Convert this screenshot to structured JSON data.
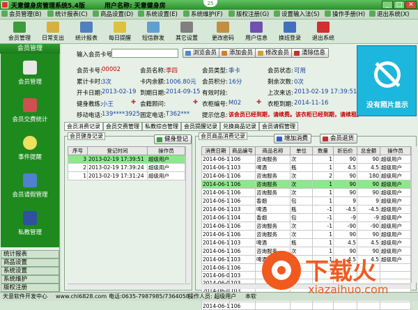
{
  "title": "天意健身房管理系统5.4版",
  "username_label": "用户名称: 天意健身房",
  "badge": "25",
  "menu": [
    "会员管理(B)",
    "统计报表(C)",
    "商品设置(D)",
    "系统设置(E)",
    "系统维护(F)",
    "版权注册(G)",
    "设置输入法(S)",
    "操作手册(H)",
    "退出系统(X)"
  ],
  "toolbar": [
    "会员管理",
    "日常支出",
    "统计报表",
    "每日提醒",
    "短信群发",
    "其它设置",
    "更改密码",
    "用户信息",
    "换班登录",
    "退出系统"
  ],
  "left": {
    "header": "会员管理",
    "nav": [
      "会员管理",
      "会员交费统计",
      "事件提醒",
      "会员请假管理",
      "私教管理"
    ],
    "bottom": [
      "统计报表",
      "商品设置",
      "系统设置",
      "系统维护",
      "版权注册"
    ]
  },
  "form": {
    "card_input_label": "输入会员卡号:",
    "card_value": "",
    "btn_browse": "浏览会员",
    "btn_add": "添加会员",
    "btn_edit": "修改会员",
    "btn_clear": "清除信息",
    "fields": {
      "card_no_label": "会员卡号:",
      "card_no": "00002",
      "name_label": "会员名称:",
      "name": "李四",
      "type_label": "会员类型:",
      "type": "季卡",
      "status_label": "会员状态:",
      "status": "可用",
      "times_label": "累计卡时:",
      "times": "3次",
      "balance_label": "卡内余额:",
      "balance": "1006.80元",
      "points_label": "会员积分:",
      "points": "16分",
      "remain_label": "剩余次数:",
      "remain": "0次",
      "open_label": "开卡日期:",
      "open": "2013-02-19",
      "expire_label": "到期日期:",
      "expire": "2014-09-15",
      "valid_label": "有效时段:",
      "valid": "",
      "last_label": "上次来访:",
      "last": "2013-02-19 17:39:51",
      "coach_label": "健身教练:",
      "coach": "小王",
      "consultant_label": "会籍顾问:",
      "consultant": "",
      "locker_label": "衣柜编号:",
      "locker": "M02",
      "locker_exp_label": "衣柜到期:",
      "locker_exp": "2014-11-16",
      "mobile_label": "移动电话:",
      "mobile": "139****3925",
      "phone_label": "固定电话:",
      "phone": "T362***",
      "notice_label": "提示信息:",
      "notice": "该会员已经到期，请续费。该衣柜已经到期，请续租。"
    },
    "no_image": "没有照片显示"
  },
  "tabs": [
    "会员消费记录",
    "会员交费管理",
    "私教综合管理",
    "会员提醒记录",
    "兑换商品记录",
    "会员请假管理"
  ],
  "fitness": {
    "group_title": "会员健身记录",
    "btn": "健身登记",
    "headers": [
      "序号",
      "登记时间",
      "操作员"
    ],
    "rows": [
      [
        "3",
        "2013-02-19 17:39:51",
        "超级用户"
      ],
      [
        "2",
        "2013-02-19 17:39:24",
        "超级用户"
      ],
      [
        "1",
        "2013-02-19 17:31:24",
        "超级用户"
      ]
    ]
  },
  "goods": {
    "group_title": "会员商品消费记录",
    "btn_add": "增加消费",
    "btn_return": "会员退货",
    "headers": [
      "消费日期",
      "商品编号",
      "商品名称",
      "单位",
      "数量",
      "折后价",
      "总金额",
      "操作员"
    ],
    "rows": [
      [
        "2014-06-12",
        "106",
        "咨询服务",
        "次",
        "1",
        "90",
        "90",
        "超级用户"
      ],
      [
        "2014-06-12",
        "103",
        "啤酒",
        "瓶",
        "1",
        "4.5",
        "4.5",
        "超级用户"
      ],
      [
        "2014-06-12",
        "106",
        "咨询服务",
        "次",
        "2",
        "90",
        "180",
        "超级用户"
      ],
      [
        "2014-06-12",
        "106",
        "咨询服务",
        "次",
        "1",
        "90",
        "90",
        "超级用户"
      ],
      [
        "2014-06-12",
        "106",
        "咨询服务",
        "次",
        "1",
        "90",
        "90",
        "超级用户"
      ],
      [
        "2014-06-12",
        "106",
        "香烟",
        "包",
        "1",
        "9",
        "9",
        "超级用户"
      ],
      [
        "2014-06-11",
        "103",
        "啤酒",
        "瓶",
        "-1",
        "-4.5",
        "-4.5",
        "超级用户"
      ],
      [
        "2014-06-11",
        "104",
        "香烟",
        "包",
        "-1",
        "-9",
        "-9",
        "超级用户"
      ],
      [
        "2014-06-11",
        "106",
        "咨询服务",
        "次",
        "-1",
        "-90",
        "-90",
        "超级用户"
      ],
      [
        "2014-06-11",
        "106",
        "咨询服务",
        "次",
        "1",
        "90",
        "90",
        "超级用户"
      ],
      [
        "2014-06-11",
        "103",
        "啤酒",
        "瓶",
        "1",
        "4.5",
        "4.5",
        "超级用户"
      ],
      [
        "2014-06-11",
        "106",
        "咨询服务",
        "次",
        "1",
        "90",
        "90",
        "超级用户"
      ],
      [
        "2014-06-11",
        "103",
        "啤酒",
        "瓶",
        "1",
        "4.5",
        "4.5",
        "超级用户"
      ],
      [
        "2014-06-11",
        "106",
        "",
        "",
        "",
        "",
        "",
        ""
      ],
      [
        "2014-06-08",
        "103",
        "",
        "",
        "",
        "",
        "",
        ""
      ],
      [
        "2014-06-08",
        "103",
        "",
        "",
        "",
        "",
        "",
        ""
      ],
      [
        "2014-06-08",
        "103",
        "",
        "",
        "",
        "",
        "",
        ""
      ],
      [
        "2014-06-11",
        "106",
        "",
        "",
        "",
        "",
        "",
        ""
      ],
      [
        "2014-06-11",
        "106",
        "",
        "",
        "",
        "",
        "",
        ""
      ]
    ]
  },
  "status": {
    "company": "天意软件开发中心",
    "site": "www.chl6828.com",
    "tel": "电话:0635-7987985/7364058",
    "operator": "操作人员: 超级用户",
    "right": "本软"
  },
  "watermark": {
    "big": "下载火",
    "small": "xiazaihuo.com"
  },
  "colors": {
    "accent": "#1e8a1e",
    "selected_row": "#8ce88c",
    "value_red": "#c00000",
    "photo_bg": "#1db6dc",
    "watermark": "#f05a1e"
  }
}
